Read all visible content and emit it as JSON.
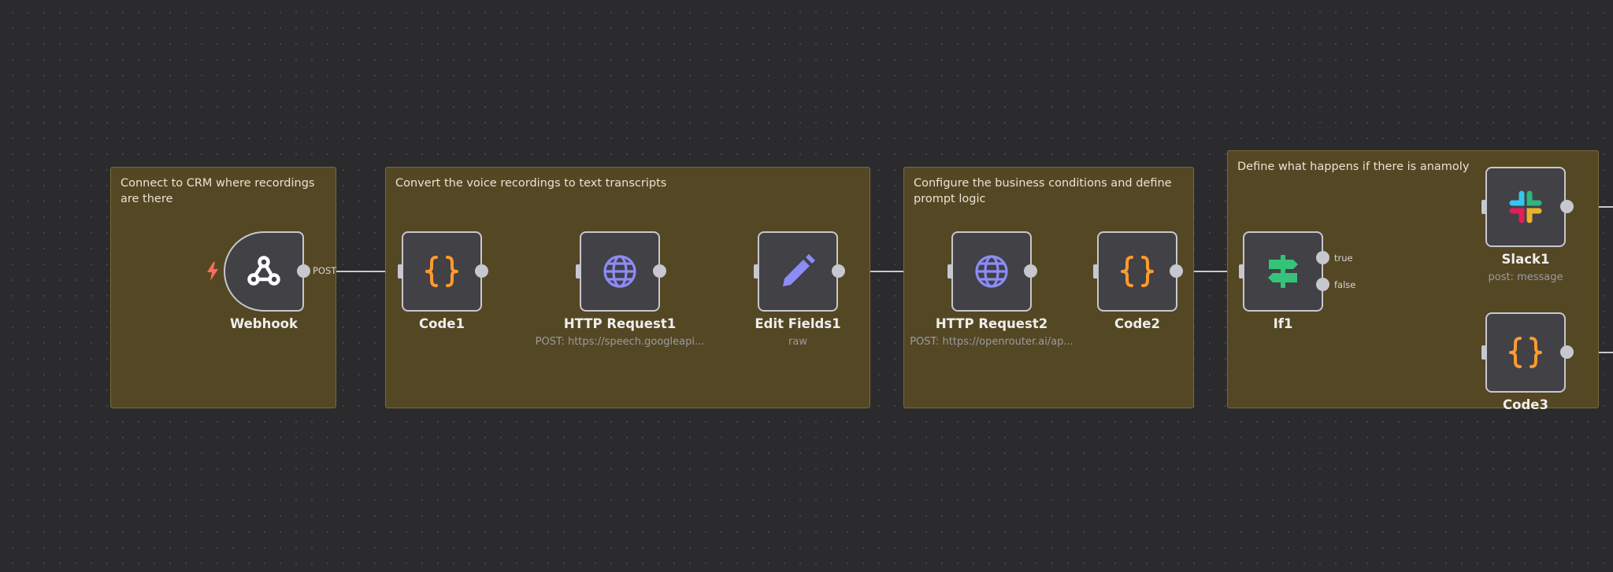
{
  "stickies": [
    {
      "id": "sticky-crm",
      "text": "Connect to CRM where recordings are there"
    },
    {
      "id": "sticky-transcripts",
      "text": "Convert the voice recordings to text transcripts"
    },
    {
      "id": "sticky-business",
      "text": "Configure the business conditions and define prompt logic"
    },
    {
      "id": "sticky-anomaly",
      "text": "Define what happens if there is anamoly"
    }
  ],
  "nodes": {
    "webhook": {
      "title": "Webhook",
      "icon": "webhook-icon"
    },
    "code1": {
      "title": "Code1",
      "icon": "code-braces-icon"
    },
    "http1": {
      "title": "HTTP Request1",
      "subtitle": "POST: https://speech.googleapi...",
      "icon": "globe-icon"
    },
    "edit1": {
      "title": "Edit Fields1",
      "subtitle": "raw",
      "icon": "pencil-icon"
    },
    "http2": {
      "title": "HTTP Request2",
      "subtitle": "POST: https://openrouter.ai/ap...",
      "icon": "globe-icon"
    },
    "code2": {
      "title": "Code2",
      "icon": "code-braces-icon"
    },
    "if1": {
      "title": "If1",
      "icon": "signpost-icon"
    },
    "slack1": {
      "title": "Slack1",
      "subtitle": "post: message",
      "icon": "slack-icon"
    },
    "code3": {
      "title": "Code3",
      "icon": "code-braces-icon"
    }
  },
  "edge_labels": {
    "webhook_out": "POST",
    "if_true": "true",
    "if_false": "false"
  },
  "colors": {
    "canvas": "#2b2b2d",
    "sticky": "#544723",
    "node": "#414146",
    "code_icon": "#ff9a2e",
    "globe_icon": "#8c8cf5",
    "pencil_icon": "#8c8cf5",
    "if_icon": "#35c37a",
    "trigger_bolt": "#ff6d5a"
  }
}
